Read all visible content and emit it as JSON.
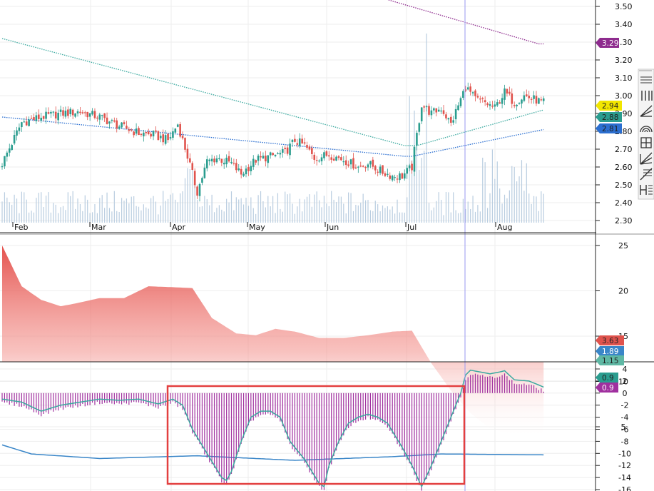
{
  "colors": {
    "up": "#2a9d8f",
    "down": "#e0534d",
    "volume": "#b9cde0",
    "upper_ma": "#8e2b8e",
    "mid_band": "#3aa99f",
    "low_band": "#2b6fd1",
    "area_top": "#e34a45",
    "bars2": "#5fb8a4",
    "line2": "#3a86c8",
    "hist3": "#a0309f",
    "line3": "#3aa99f",
    "crosshair": "#9a9af0",
    "highlight": "#e34040"
  },
  "toolbar": {
    "icons": [
      "horizontal-line-icon",
      "vertical-lines-icon",
      "trend-angle-icon",
      "gann-fan-arc-icon",
      "grid-box-icon",
      "fan-lines-icon",
      "fib-retracement-icon",
      "horizontal-levels-icon"
    ]
  },
  "chart_data": [
    {
      "type": "candlestick",
      "x_labels": [
        "Feb",
        "Mar",
        "Apr",
        "May",
        "Jun",
        "Jul",
        "Aug"
      ],
      "y_ticks": [
        "3.50",
        "3.40",
        "3.30",
        "3.20",
        "3.10",
        "3.00",
        "2.90",
        "2.80",
        "2.70",
        "2.60",
        "2.50",
        "2.40",
        "2.30"
      ],
      "ylim": [
        2.28,
        3.53
      ],
      "close_key": [
        [
          0,
          2.62
        ],
        [
          8,
          2.85
        ],
        [
          16,
          2.88
        ],
        [
          24,
          2.9
        ],
        [
          32,
          2.91
        ],
        [
          40,
          2.88
        ],
        [
          48,
          2.83
        ],
        [
          56,
          2.79
        ],
        [
          62,
          2.78
        ],
        [
          68,
          2.75
        ],
        [
          72,
          2.84
        ],
        [
          76,
          2.66
        ],
        [
          80,
          2.46
        ],
        [
          84,
          2.63
        ],
        [
          88,
          2.65
        ],
        [
          94,
          2.62
        ],
        [
          98,
          2.56
        ],
        [
          104,
          2.64
        ],
        [
          110,
          2.66
        ],
        [
          116,
          2.68
        ],
        [
          120,
          2.75
        ],
        [
          124,
          2.72
        ],
        [
          128,
          2.65
        ],
        [
          134,
          2.67
        ],
        [
          140,
          2.64
        ],
        [
          146,
          2.6
        ],
        [
          150,
          2.62
        ],
        [
          156,
          2.57
        ],
        [
          160,
          2.55
        ],
        [
          164,
          2.55
        ],
        [
          168,
          2.6
        ],
        [
          170,
          2.78
        ],
        [
          172,
          2.95
        ],
        [
          176,
          2.9
        ],
        [
          180,
          2.93
        ],
        [
          184,
          2.84
        ],
        [
          188,
          2.98
        ],
        [
          190,
          3.05
        ],
        [
          194,
          2.98
        ],
        [
          198,
          2.96
        ],
        [
          202,
          2.93
        ],
        [
          206,
          3.02
        ],
        [
          210,
          2.96
        ],
        [
          214,
          3.0
        ],
        [
          218,
          2.98
        ],
        [
          222,
          2.96
        ]
      ],
      "overlays": {
        "upper_ma": {
          "last": 3.29,
          "label": "3.29"
        },
        "middle_band": {
          "last": 2.88,
          "label": "2.88"
        },
        "lower_band": {
          "last": 2.81,
          "label": "2.81"
        },
        "last_price": {
          "last": 2.94,
          "label": "2.94"
        }
      },
      "volume": "background volume histogram, peaks near Apr and Jul"
    },
    {
      "type": "area",
      "y_ticks": [
        "25",
        "20",
        "15",
        "10",
        "5"
      ],
      "ylim": [
        0,
        27.5
      ],
      "area_key": [
        [
          0,
          25
        ],
        [
          8,
          20.5
        ],
        [
          16,
          19
        ],
        [
          24,
          18.3
        ],
        [
          30,
          18.6
        ],
        [
          40,
          19.2
        ],
        [
          50,
          19.2
        ],
        [
          60,
          20.5
        ],
        [
          70,
          20.4
        ],
        [
          78,
          20.3
        ],
        [
          86,
          17
        ],
        [
          96,
          15.3
        ],
        [
          104,
          15.1
        ],
        [
          112,
          15.8
        ],
        [
          120,
          15.5
        ],
        [
          130,
          14.8
        ],
        [
          140,
          14.8
        ],
        [
          150,
          15.1
        ],
        [
          160,
          15.5
        ],
        [
          168,
          15.6
        ],
        [
          176,
          12
        ],
        [
          184,
          9
        ],
        [
          192,
          6.5
        ],
        [
          200,
          4.8
        ],
        [
          210,
          4.0
        ],
        [
          222,
          3.6
        ]
      ],
      "bars_key": [
        [
          0,
          11.5
        ],
        [
          20,
          8
        ],
        [
          40,
          6
        ],
        [
          60,
          5.5
        ],
        [
          80,
          5.5
        ],
        [
          100,
          5
        ],
        [
          120,
          4.5
        ],
        [
          140,
          4.5
        ],
        [
          160,
          4.5
        ],
        [
          172,
          4
        ],
        [
          180,
          2.5
        ],
        [
          200,
          1.8
        ],
        [
          222,
          1.3
        ]
      ],
      "line_key": [
        [
          0,
          3.0
        ],
        [
          12,
          2.0
        ],
        [
          40,
          1.5
        ],
        [
          80,
          1.8
        ],
        [
          120,
          1.3
        ],
        [
          160,
          1.7
        ],
        [
          180,
          2.0
        ],
        [
          222,
          1.9
        ]
      ],
      "badges": [
        "3.63",
        "1.89",
        "1.15"
      ]
    },
    {
      "type": "histogram",
      "y_ticks": [
        "4",
        "2",
        "0",
        "-2",
        "-4",
        "-6",
        "-8",
        "-10",
        "-12",
        "-14",
        "-16"
      ],
      "ylim": [
        -16.2,
        4.6
      ],
      "key": [
        [
          0,
          -1
        ],
        [
          8,
          -1.5
        ],
        [
          16,
          -3
        ],
        [
          24,
          -2
        ],
        [
          32,
          -1.5
        ],
        [
          40,
          -1
        ],
        [
          48,
          -1.2
        ],
        [
          56,
          -1
        ],
        [
          64,
          -1.8
        ],
        [
          70,
          -1
        ],
        [
          74,
          -2
        ],
        [
          78,
          -6
        ],
        [
          84,
          -10
        ],
        [
          90,
          -14
        ],
        [
          92,
          -14.5
        ],
        [
          94,
          -13
        ],
        [
          98,
          -8
        ],
        [
          102,
          -4
        ],
        [
          106,
          -3
        ],
        [
          110,
          -3
        ],
        [
          114,
          -4
        ],
        [
          118,
          -8
        ],
        [
          124,
          -11
        ],
        [
          130,
          -15
        ],
        [
          132,
          -15.5
        ],
        [
          134,
          -12
        ],
        [
          138,
          -8
        ],
        [
          142,
          -5
        ],
        [
          146,
          -4
        ],
        [
          150,
          -3.5
        ],
        [
          154,
          -4
        ],
        [
          158,
          -5
        ],
        [
          164,
          -9
        ],
        [
          168,
          -12
        ],
        [
          172,
          -15.5
        ],
        [
          176,
          -12
        ],
        [
          180,
          -8
        ],
        [
          184,
          -4
        ],
        [
          188,
          0
        ],
        [
          190,
          3
        ],
        [
          192,
          3.8
        ],
        [
          196,
          3.5
        ],
        [
          200,
          3.2
        ],
        [
          204,
          3.5
        ],
        [
          206,
          3.7
        ],
        [
          210,
          2.2
        ],
        [
          216,
          2
        ],
        [
          222,
          1
        ]
      ],
      "badges": [
        "0.9",
        "0.9"
      ]
    }
  ]
}
